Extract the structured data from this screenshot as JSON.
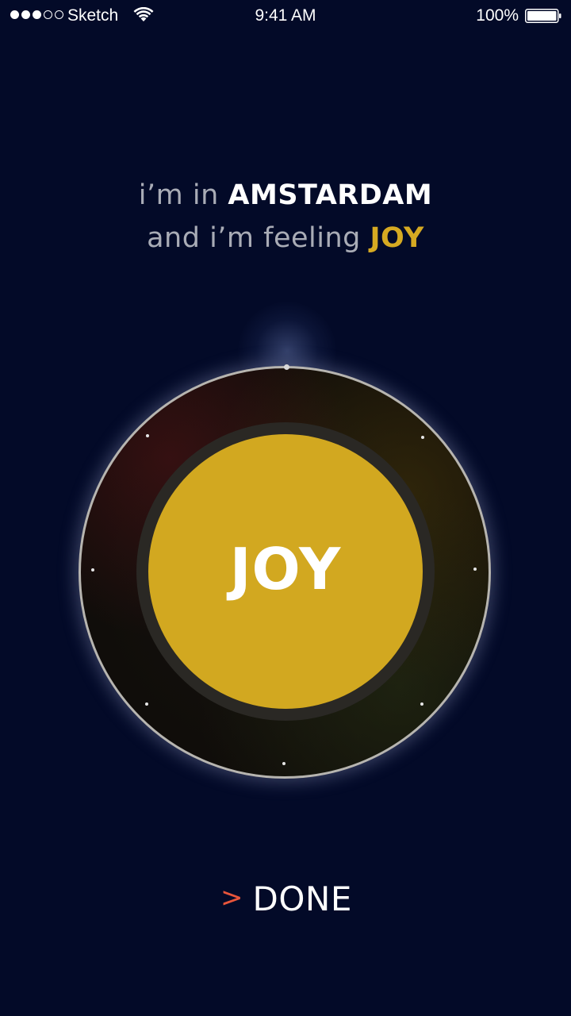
{
  "status_bar": {
    "carrier": "Sketch",
    "time": "9:41 AM",
    "battery": "100%",
    "signal_icon": "signal-dots-icon",
    "wifi_icon": "wifi-icon",
    "battery_icon": "battery-icon"
  },
  "headline": {
    "prefix": "i’m in ",
    "city": "AMSTARDAM",
    "feeling_prefix": "and i’m feeling ",
    "mood": "JOY"
  },
  "dial": {
    "selected_mood": "JOY",
    "accent_color": "#d2a820"
  },
  "done": {
    "label": "DONE",
    "icon": "chevron-right-icon",
    "icon_color": "#e8553b"
  },
  "colors": {
    "background": "#030a28",
    "muted_text": "#a9acb6",
    "mood_text": "#d6aa22"
  }
}
